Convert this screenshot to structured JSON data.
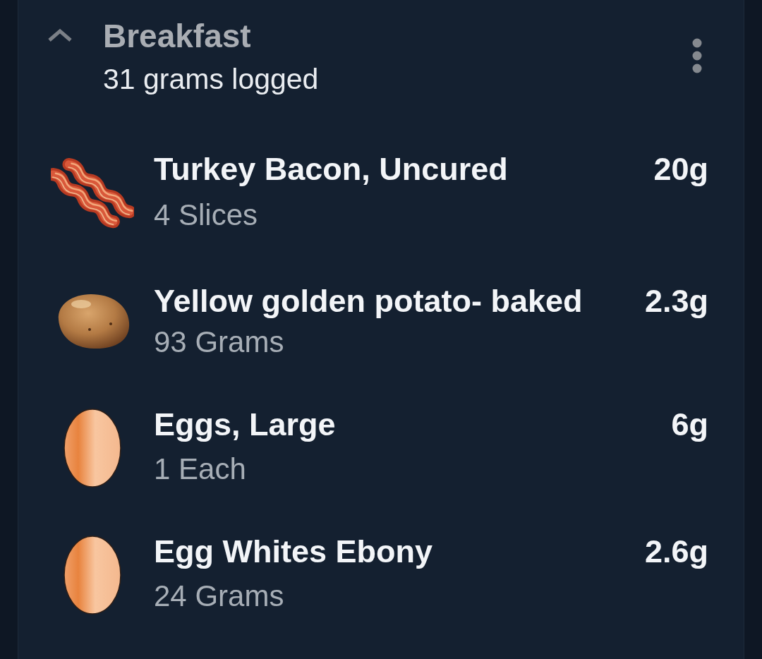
{
  "meal": {
    "title": "Breakfast",
    "summary": "31 grams logged",
    "expanded": true
  },
  "foods": [
    {
      "kind": "bacon",
      "name": "Turkey Bacon, Uncured",
      "serving": "4 Slices",
      "amount": "20g"
    },
    {
      "kind": "potato",
      "name": "Yellow golden potato- baked",
      "serving": "93 Grams",
      "amount": "2.3g"
    },
    {
      "kind": "egg",
      "name": "Eggs, Large",
      "serving": "1 Each",
      "amount": "6g"
    },
    {
      "kind": "egg",
      "name": "Egg Whites Ebony",
      "serving": "24 Grams",
      "amount": "2.6g"
    }
  ]
}
